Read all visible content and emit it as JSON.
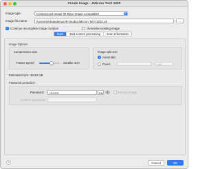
{
  "window": {
    "title": "Create Image - JMicron Tech 3202"
  },
  "image_type": {
    "label": "Image type:",
    "value": "Compressed Image (R-Drive Image compatible)"
  },
  "image_file_name": {
    "label": "Image file name:",
    "value": "/Users/emilyanderson/R-Studio/JMicron Tech 3202.rdr",
    "browse_label": "..."
  },
  "options": {
    "continue_incomplete": {
      "label": "Continue incomplete image creation",
      "checked": true
    },
    "overwrite_existing": {
      "label": "Overwrite existing image",
      "checked": false
    }
  },
  "tabs": [
    {
      "label": "Main",
      "active": true
    },
    {
      "label": "Bad sectors processing",
      "active": false
    },
    {
      "label": "Scan Information",
      "active": false
    }
  ],
  "image_options": {
    "title": "Image Options",
    "compression": {
      "title": "Compression ratio",
      "left_label": "Faster speed",
      "right_label": "Smaller size",
      "level_fraction": 0.6
    },
    "split": {
      "title": "Image split size",
      "automatic_label": "Automatic",
      "fixed_label": "Fixed:",
      "fixed_unit": "GB",
      "selected": "automatic"
    },
    "estimated_size": "Estimated size: 48.83 GB"
  },
  "password": {
    "title": "Password protection",
    "password_label": "Password:",
    "password_value": "•••••••••",
    "lang_badge": "EN",
    "confirm_label": "Confirm password:",
    "encrypt_label": "Encrypt image"
  },
  "footer": {
    "help_label": "?",
    "cancel_label": "Cancel",
    "ok_label": "OK"
  },
  "colors": {
    "accent": "#2b7de9"
  }
}
